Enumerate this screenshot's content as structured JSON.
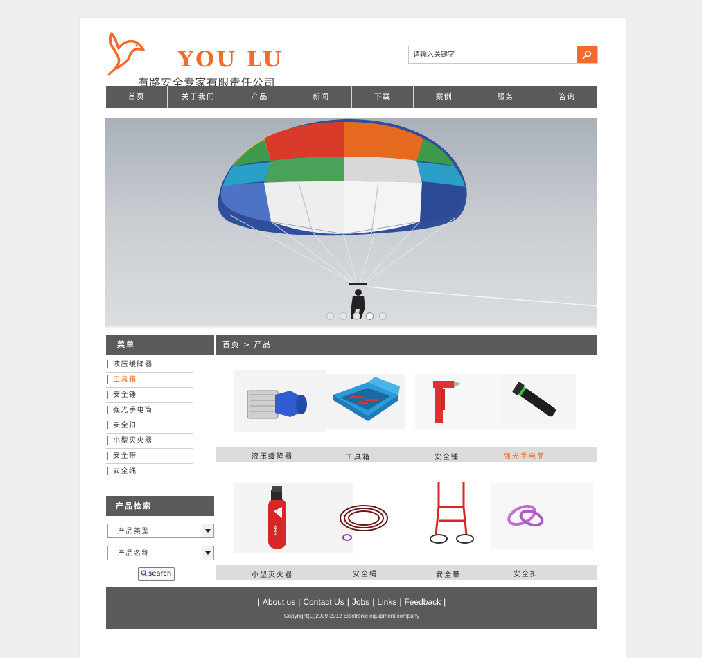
{
  "brand": {
    "name": "YOU LU",
    "company": "有路安全专家有限责任公司"
  },
  "search": {
    "placeholder": "请输入关键字"
  },
  "nav": {
    "items": [
      "首页",
      "关于我们",
      "产品",
      "新闻",
      "下载",
      "案例",
      "服务",
      "咨询"
    ]
  },
  "banner": {
    "slide_count": 5,
    "active_slide": 4
  },
  "sidebar": {
    "menu_title": "菜单",
    "menu_items": [
      {
        "label": "液压缓降器",
        "active": false
      },
      {
        "label": "工具箱",
        "active": true
      },
      {
        "label": "安全锤",
        "active": false
      },
      {
        "label": "强光手电筒",
        "active": false
      },
      {
        "label": "安全扣",
        "active": false
      },
      {
        "label": "小型灭火器",
        "active": false
      },
      {
        "label": "安全带",
        "active": false
      },
      {
        "label": "安全绳",
        "active": false
      }
    ],
    "search_title": "产品检索",
    "product_type": "产品类型",
    "product_name": "产品名称",
    "search_button": "search"
  },
  "breadcrumb": {
    "text": "首页 > 产品"
  },
  "products": {
    "row1": [
      "液压缓降器",
      "工具箱",
      "安全锤",
      "强光手电筒"
    ],
    "row2": [
      "小型灭火器",
      "安全绳",
      "安全带",
      "安全扣"
    ],
    "highlight": "强光手电筒"
  },
  "footer": {
    "links": [
      "About us",
      "Contact Us",
      "Jobs",
      "Links",
      "Feedback"
    ],
    "copyright": "Copyright(C)2009-2012 Electronic equipment company"
  },
  "colors": {
    "accent": "#f26b2b",
    "bar": "#5b5a5a"
  }
}
